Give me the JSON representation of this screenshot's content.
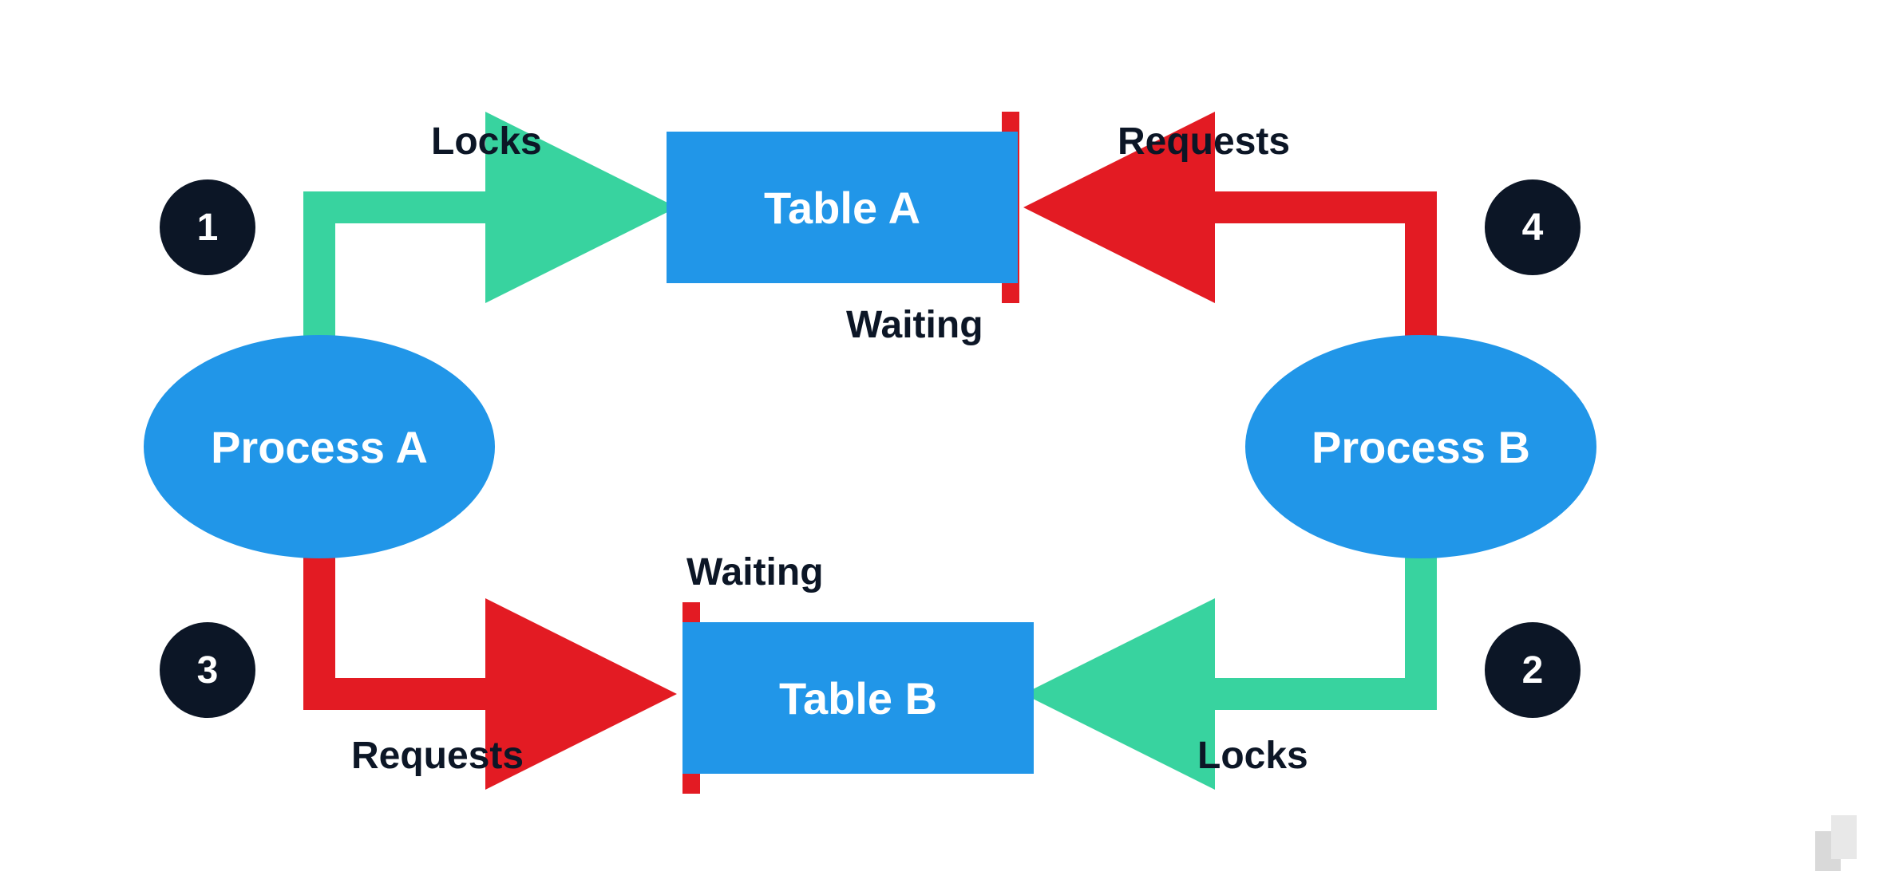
{
  "nodes": {
    "process_a": "Process A",
    "process_b": "Process B",
    "table_a": "Table A",
    "table_b": "Table B"
  },
  "steps": {
    "s1": "1",
    "s2": "2",
    "s3": "3",
    "s4": "4"
  },
  "labels": {
    "locks_top": "Locks",
    "requests_top": "Requests",
    "waiting_top": "Waiting",
    "waiting_bottom": "Waiting",
    "requests_bottom": "Requests",
    "locks_bottom": "Locks"
  },
  "colors": {
    "lock": "#38d39f",
    "request": "#e31b23",
    "node": "#2196e8",
    "step": "#0c1626"
  }
}
